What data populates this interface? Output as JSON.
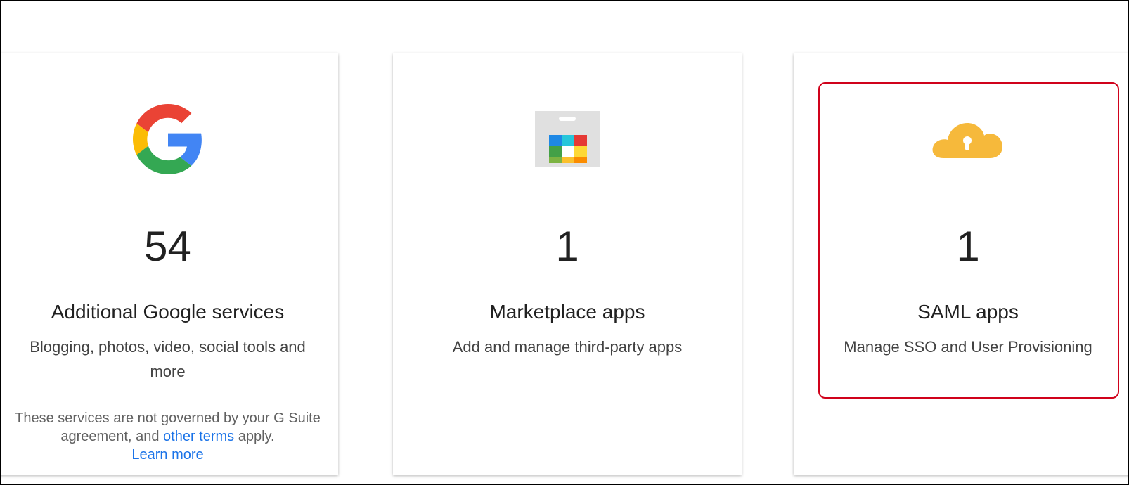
{
  "cards": [
    {
      "count": "54",
      "title": "Additional Google services",
      "description": "Blogging, photos, video, social tools and more",
      "note": {
        "text_before": "These services are not governed by your G Suite agreement, and ",
        "link_terms": "other terms",
        "text_after": " apply.",
        "link_learn": "Learn more"
      },
      "icon": "google-g-icon"
    },
    {
      "count": "1",
      "title": "Marketplace apps",
      "description": "Add and manage third-party apps",
      "icon": "marketplace-icon"
    },
    {
      "count": "1",
      "title": "SAML apps",
      "description": "Manage SSO and User Provisioning",
      "icon": "cloud-lock-icon"
    }
  ],
  "colors": {
    "highlight": "#d0021b",
    "link": "#1a73e8",
    "cloud": "#f6b93b"
  }
}
